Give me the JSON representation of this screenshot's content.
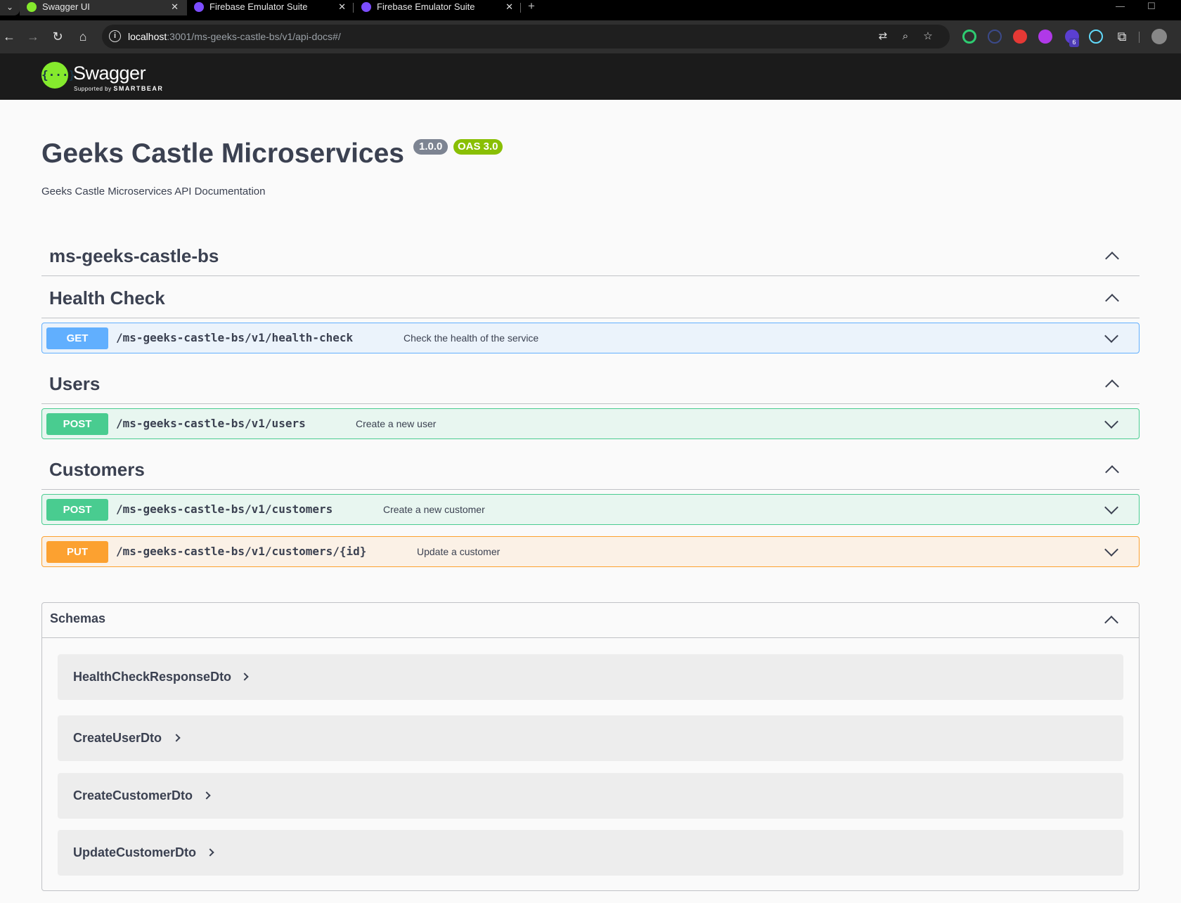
{
  "browser": {
    "tabs": [
      {
        "title": "Swagger UI",
        "close": "✕"
      },
      {
        "title": "Firebase Emulator Suite",
        "close": "✕"
      },
      {
        "title": "Firebase Emulator Suite",
        "close": "✕"
      }
    ],
    "new_tab": "+",
    "url_host": "localhost",
    "url_rest": ":3001/ms-geeks-castle-bs/v1/api-docs#/",
    "extension_badge": "6"
  },
  "swagger": {
    "logo_glyph": "{···}",
    "brand": "Swagger",
    "supported_prefix": "Supported by",
    "supported_by": "SMARTBEAR"
  },
  "info": {
    "title": "Geeks Castle Microservices",
    "version": "1.0.0",
    "oas": "OAS 3.0",
    "description": "Geeks Castle Microservices API Documentation"
  },
  "sections": {
    "root": {
      "title": "ms-geeks-castle-bs"
    },
    "health": {
      "title": "Health Check"
    },
    "users": {
      "title": "Users"
    },
    "customers": {
      "title": "Customers"
    }
  },
  "operations": {
    "health_get": {
      "method": "GET",
      "path": "/ms-geeks-castle-bs/v1/health-check",
      "summary": "Check the health of the service"
    },
    "users_post": {
      "method": "POST",
      "path": "/ms-geeks-castle-bs/v1/users",
      "summary": "Create a new user"
    },
    "customers_post": {
      "method": "POST",
      "path": "/ms-geeks-castle-bs/v1/customers",
      "summary": "Create a new customer"
    },
    "customers_put": {
      "method": "PUT",
      "path": "/ms-geeks-castle-bs/v1/customers/{id}",
      "summary": "Update a customer"
    }
  },
  "schemas": {
    "title": "Schemas",
    "models": [
      "HealthCheckResponseDto",
      "CreateUserDto",
      "CreateCustomerDto",
      "UpdateCustomerDto"
    ]
  },
  "colors": {
    "get": "#61affe",
    "post": "#49cc90",
    "put": "#fca130",
    "swagger_green": "#85ea2d",
    "oas_badge": "#89bf04"
  }
}
